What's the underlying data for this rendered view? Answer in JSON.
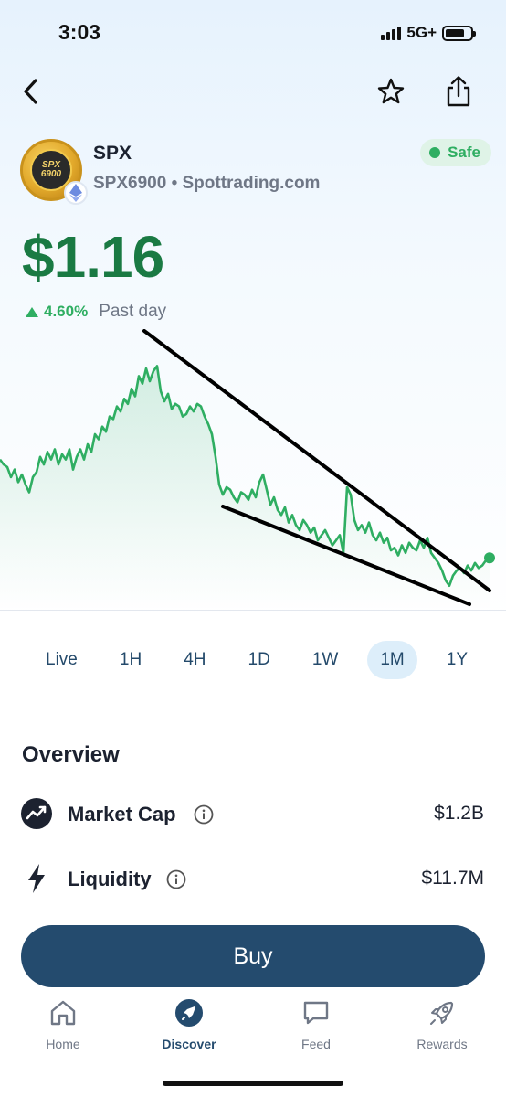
{
  "status_bar": {
    "time": "3:03",
    "network": "5G+"
  },
  "token": {
    "symbol": "SPX",
    "subtitle": "SPX6900 • Spottrading.com",
    "logo_text": "SPX 6900",
    "safety_label": "Safe",
    "price": "$1.16",
    "change_pct": "4.60%",
    "change_period": "Past day"
  },
  "colors": {
    "up": "#2fae62",
    "price": "#1a7a43",
    "primary": "#244b6e"
  },
  "chart_data": {
    "type": "line",
    "x": [
      0,
      4,
      8,
      12,
      16,
      20,
      24,
      28,
      32,
      36,
      40,
      44,
      48,
      52,
      56,
      60,
      64,
      68,
      72,
      76,
      80,
      84,
      88,
      92,
      96,
      100,
      104,
      108,
      112,
      116,
      120,
      124,
      128,
      132,
      136,
      140,
      144,
      148,
      152,
      156,
      160,
      164,
      168,
      172,
      176,
      180,
      184,
      188,
      192,
      196,
      200,
      204,
      208,
      212,
      216,
      220,
      224,
      228,
      232,
      236,
      240,
      244,
      248,
      252,
      256,
      260,
      264,
      268,
      272,
      276,
      280,
      284,
      288,
      292,
      296,
      300,
      304,
      308,
      312,
      316,
      320,
      324,
      328,
      332,
      336,
      340,
      344,
      348,
      352,
      356,
      360,
      364,
      368,
      372,
      376,
      380,
      384,
      388,
      392,
      396,
      400,
      404,
      408,
      412,
      416,
      420,
      424,
      428,
      432,
      436,
      440,
      444,
      448,
      452,
      456,
      460,
      464,
      468,
      472,
      476,
      480,
      484,
      488,
      492,
      496,
      500,
      504,
      508,
      512,
      516,
      520,
      524,
      528,
      532,
      536
    ],
    "values": [
      1.62,
      1.6,
      1.59,
      1.55,
      1.58,
      1.53,
      1.56,
      1.52,
      1.49,
      1.55,
      1.57,
      1.63,
      1.6,
      1.65,
      1.62,
      1.66,
      1.6,
      1.64,
      1.62,
      1.66,
      1.58,
      1.63,
      1.66,
      1.62,
      1.68,
      1.65,
      1.72,
      1.7,
      1.75,
      1.73,
      1.79,
      1.78,
      1.83,
      1.81,
      1.86,
      1.84,
      1.9,
      1.87,
      1.95,
      1.92,
      1.98,
      1.93,
      1.97,
      1.99,
      1.89,
      1.85,
      1.88,
      1.82,
      1.84,
      1.83,
      1.79,
      1.8,
      1.83,
      1.81,
      1.84,
      1.83,
      1.79,
      1.76,
      1.72,
      1.63,
      1.52,
      1.48,
      1.51,
      1.5,
      1.47,
      1.45,
      1.49,
      1.48,
      1.46,
      1.5,
      1.47,
      1.53,
      1.56,
      1.5,
      1.44,
      1.47,
      1.42,
      1.4,
      1.43,
      1.37,
      1.4,
      1.36,
      1.34,
      1.38,
      1.36,
      1.33,
      1.35,
      1.3,
      1.32,
      1.34,
      1.31,
      1.28,
      1.3,
      1.32,
      1.25,
      1.51,
      1.48,
      1.38,
      1.34,
      1.36,
      1.33,
      1.37,
      1.32,
      1.3,
      1.33,
      1.29,
      1.31,
      1.26,
      1.27,
      1.24,
      1.28,
      1.25,
      1.29,
      1.27,
      1.26,
      1.3,
      1.27,
      1.31,
      1.25,
      1.23,
      1.21,
      1.18,
      1.14,
      1.12,
      1.16,
      1.18,
      1.19,
      1.17,
      1.2,
      1.18,
      1.21,
      1.19,
      1.2,
      1.22,
      1.23
    ],
    "ylim": [
      1.05,
      2.1
    ],
    "end_marker": "latest-price-dot",
    "grid": false
  },
  "ranges": [
    "Live",
    "1H",
    "4H",
    "1D",
    "1W",
    "1M",
    "1Y"
  ],
  "active_range": "1M",
  "overview": {
    "title": "Overview",
    "market_cap": {
      "label": "Market Cap",
      "value": "$1.2B"
    },
    "liquidity": {
      "label": "Liquidity",
      "value": "$11.7M"
    }
  },
  "buy_label": "Buy",
  "tabs": [
    {
      "label": "Home",
      "icon": "home-icon"
    },
    {
      "label": "Discover",
      "icon": "rocket-icon"
    },
    {
      "label": "Feed",
      "icon": "chat-icon"
    },
    {
      "label": "Rewards",
      "icon": "shuttle-icon"
    }
  ],
  "active_tab": "Discover"
}
